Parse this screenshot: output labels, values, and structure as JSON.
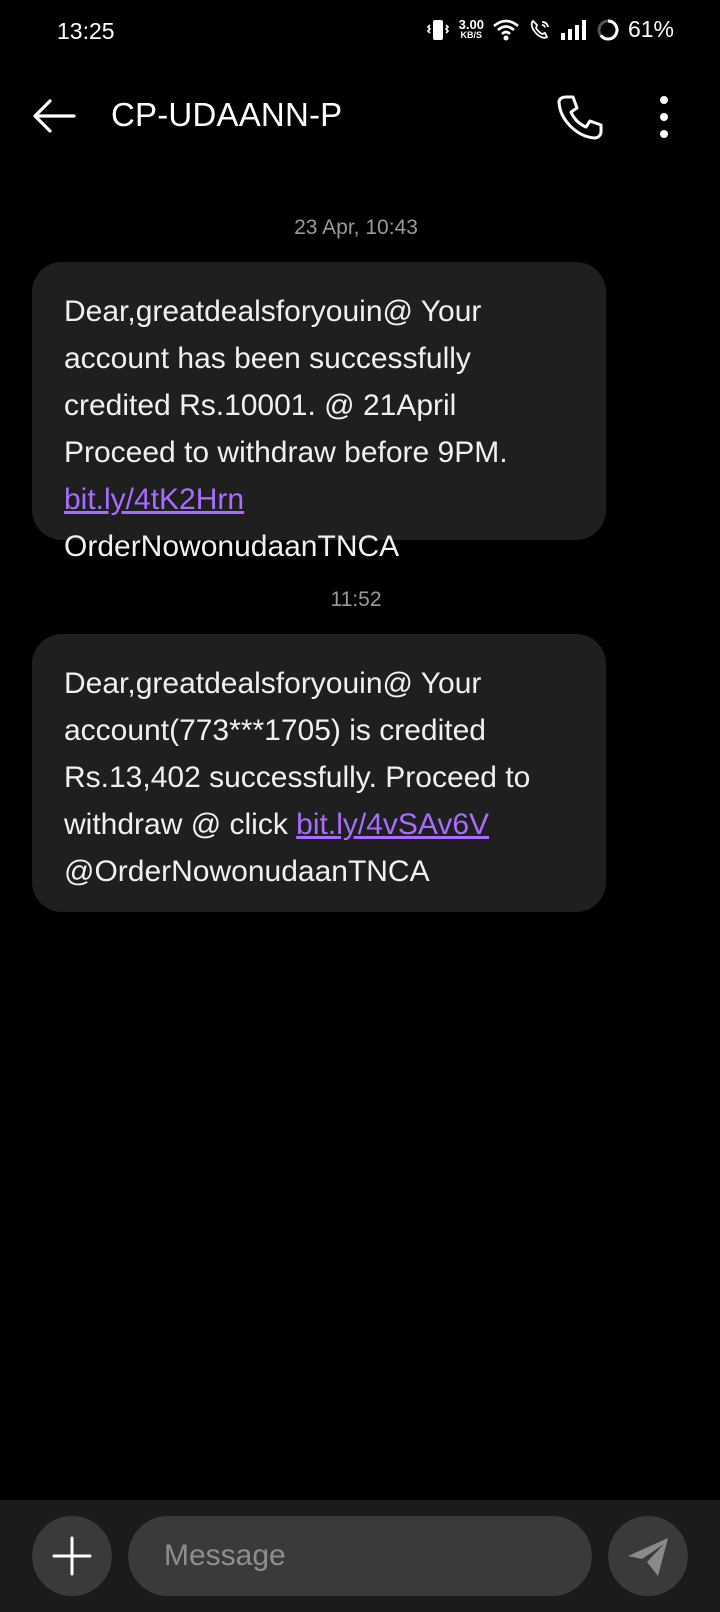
{
  "status_bar": {
    "time": "13:25",
    "net_speed_value": "3.00",
    "net_speed_unit": "KB/S",
    "battery": "61%",
    "icons": [
      "vibrate-icon",
      "wifi-icon",
      "wifi-call-icon",
      "signal-icon",
      "battery-icon"
    ]
  },
  "header": {
    "title": "CP-UDAANN-P",
    "icons": [
      "back-arrow-icon",
      "phone-icon",
      "more-vert-icon"
    ]
  },
  "messages": [
    {
      "timestamp": "23 Apr, 10:43",
      "text_before": "Dear,greatdealsforyouin@ Your account has been successfully credited Rs.10001. @ 21April Proceed to withdraw before 9PM. ",
      "link": "bit.ly/4tK2Hrn",
      "text_after": " OrderNowonudaanTNCA"
    },
    {
      "timestamp": "11:52",
      "text_before": "Dear,greatdealsforyouin@ Your account(773***1705) is credited Rs.13,402 successfully. Proceed to withdraw @ click ",
      "link": "bit.ly/4vSAv6V",
      "text_after": " @OrderNowonudaanTNCA"
    }
  ],
  "composer": {
    "placeholder": "Message",
    "icons": [
      "plus-icon",
      "send-icon"
    ]
  },
  "colors": {
    "background": "#000000",
    "bubble": "#1f1f1f",
    "link": "#a86cff",
    "bottom_bar": "#1b1b1b"
  }
}
